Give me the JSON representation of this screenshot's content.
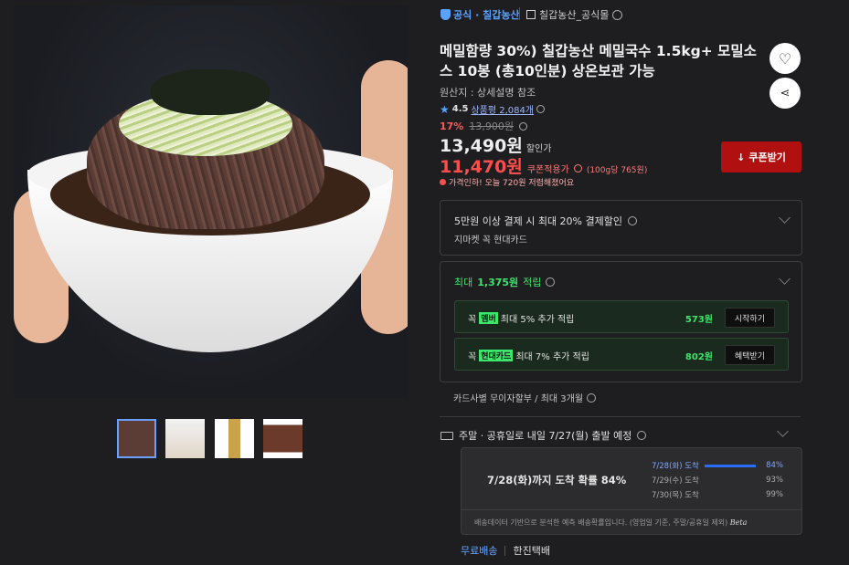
{
  "header": {
    "official_badge": "공식 · 칠갑농산",
    "store_name": "칠갑농산_공식몰"
  },
  "product": {
    "title": "메밀함량 30%) 칠갑농산 메밀국수 1.5kg+ 모밀소스 10봉 (총10인분) 상온보관 가능",
    "origin": "원산지 : 상세설명 참조",
    "rating": "4.5",
    "reviews": "상품평 2,084개",
    "discount_rate": "17%",
    "original_price": "13,900원",
    "sale_price": "13,490원",
    "sale_label": "할인가",
    "coupon_price": "11,470원",
    "coupon_label": "쿠폰적용가",
    "unit_price": "(100g당 765원)",
    "price_alert": "가격인하! 오늘 720원 저렴해졌어요",
    "coupon_button": "쿠폰받기"
  },
  "card_promo": {
    "title": "5만원 이상 결제 시 최대 20% 결제할인",
    "subtitle": "지마켓 꼭 현대카드"
  },
  "points": {
    "title_prefix": "최대 ",
    "amount": "1,375원",
    "title_suffix": " 적립",
    "rows": [
      {
        "prefix": "꼭",
        "tag": "멤버",
        "text": "최대 5% 추가 적립",
        "value": "573원",
        "button": "시작하기"
      },
      {
        "prefix": "꼭",
        "tag": "현대카드",
        "text": "최대 7% 추가 적립",
        "value": "802원",
        "button": "혜택받기"
      }
    ]
  },
  "installment": "카드사별 무이자할부 / 최대 3개월",
  "shipping": {
    "headline": "주말 · 공휴일로 내일 7/27(월) 출발 예정",
    "prob_main": "7/28(화)까지 도착 확률 84%",
    "rows": [
      {
        "date": "7/28(화) 도착",
        "pct": "84%",
        "fill": 0.84
      },
      {
        "date": "7/29(수) 도착",
        "pct": "93%",
        "fill": 0
      },
      {
        "date": "7/30(목) 도착",
        "pct": "99%",
        "fill": 0
      }
    ],
    "note": "배송데이터 기반으로 분석한 예측 배송확률입니다. (영업일 기준, 주말/공휴일 제외)",
    "beta": "Beta",
    "free": "무료배송",
    "carrier": "한진택배"
  },
  "colors": {
    "accent_blue": "#5aa2ff",
    "sale_red": "#ff4d4d",
    "coupon_red": "#b01010",
    "points_green": "#3ce56c"
  }
}
